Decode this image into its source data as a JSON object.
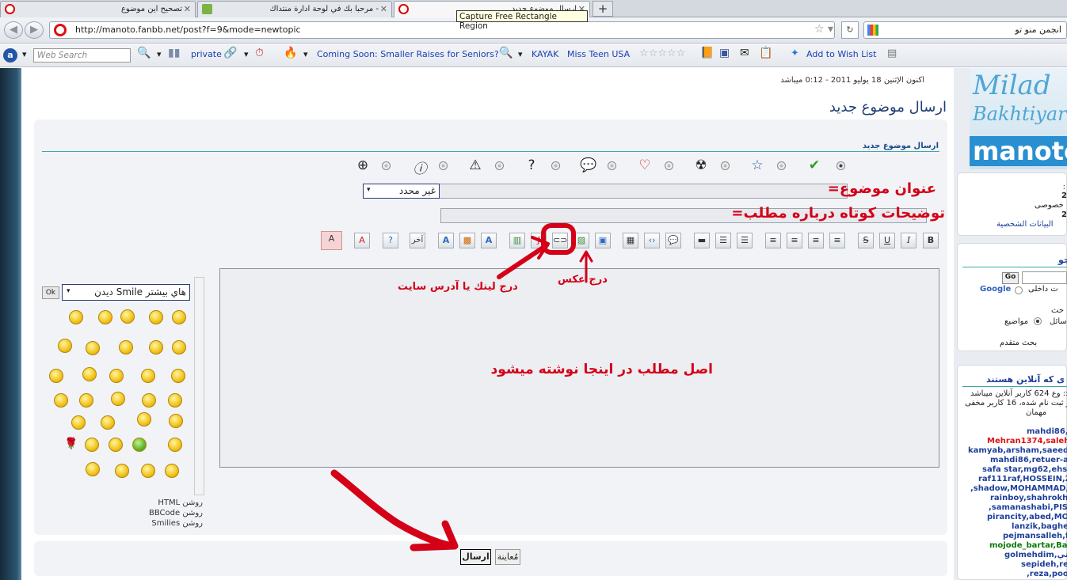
{
  "browser": {
    "tabs": [
      {
        "title": "تصحيح اين موضوع"
      },
      {
        "title": "مرحبا بك في لوحة ادارة منتداك -"
      },
      {
        "title": "ارسال موضوع جديد"
      }
    ],
    "tooltip": "Capture Free Rectangle Region",
    "url": "http://manoto.fanbb.net/post?f=9&mode=newtopic",
    "search_text": "انجمن منو تو"
  },
  "toolbar": {
    "web_search_placeholder": "Web Search",
    "private": "private",
    "news_link": "Coming Soon: Smaller Raises for Seniors?",
    "kayak": "KAYAK",
    "miss_teen": "Miss Teen USA",
    "wish_list": "Add to Wish List"
  },
  "page": {
    "date": "اكنون الإثنين 18 يوليو 2011 - 0:12 ميباشد",
    "title": "ارسال موضوع جديد",
    "section_title": "ارسال موضوع جديد",
    "subject_select": "غير محدد",
    "smile_select": "ديدن Smile هاي بيشتر",
    "ok_label": "Ok",
    "options": [
      "HTML روشن",
      "BBCode روشن",
      "Smilies روشن"
    ],
    "editor_btn_other": "آخر",
    "send_button": "ارسال",
    "preview_button": "مُعاينة"
  },
  "annotations": {
    "subject_label": "عنوان موضوع=",
    "desc_label": "توضيحات كوتاه درباره مطلب=",
    "image_label": "درج عكس",
    "link_label": "درج لينك يا آدرس سايت",
    "body_label": "اصل مطلب در اينجا نوشته ميشود"
  },
  "sidebar": {
    "lines": [
      ":",
      "2",
      "خصوصى :",
      "2"
    ],
    "profile_link": "البيانات الشخصية",
    "search_title": "جو",
    "go_button": "Go",
    "google_label": "Google",
    "inside_site": "ت داخلى",
    "search_word": "حث",
    "messages": "سائل",
    "topics": "مواضيع",
    "advanced": "بحث متقدم",
    "online_title": "ى كه آنلاين هستند",
    "online_text": [
      "وع 624 كاربر آنلاين ميباشد ::",
      "ر ثبت نام شده، 16 كاربر مخفى",
      "مهمان"
    ],
    "users": [
      "mahdi86,",
      "Mehran1374,saleh",
      "kamyab,arsham,saeed ka",
      "mahdi86,retuer-abe",
      "safa star,mg62,ehsan",
      "raf111raf,HOSSEIN,ZA",
      ",shadow,MOHAMMAD,m",
      "rainboy,shahrokh,se",
      ",samanashabi,PISHK",
      "pirancity,abed,MOJT",
      "lanzik,bagher",
      "pejmansalleh,fa",
      "mojode_bartar,Bah",
      "golmehdim,كاني",
      "sepideh,rev",
      ",reza,poor"
    ]
  },
  "colors": {
    "annotation_red": "#d40018",
    "title_blue": "#1f3f6e",
    "link_blue": "#1a3fb5"
  }
}
